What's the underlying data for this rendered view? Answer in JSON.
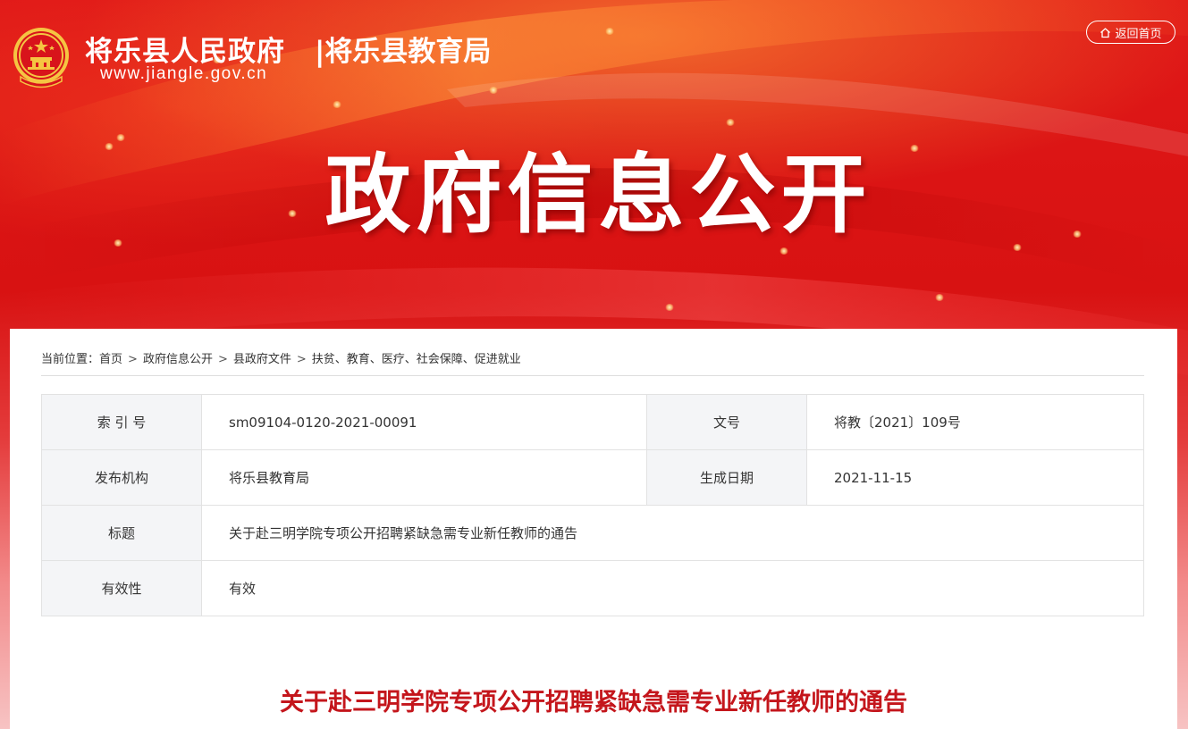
{
  "header": {
    "site_name": "将乐县人民政府",
    "site_url": "www.jiangle.gov.cn",
    "department": "|将乐县教育局",
    "home_button": "返回首页"
  },
  "hero": {
    "title": "政府信息公开"
  },
  "breadcrumb": {
    "prefix": "当前位置：",
    "items": [
      "首页",
      "政府信息公开",
      "县政府文件",
      "扶贫、教育、医疗、社会保障、促进就业"
    ],
    "separator": ">"
  },
  "meta": {
    "index_label": "索 引 号",
    "index_value": "sm09104-0120-2021-00091",
    "doc_no_label": "文号",
    "doc_no_value": "将教〔2021〕109号",
    "publisher_label": "发布机构",
    "publisher_value": "将乐县教育局",
    "date_label": "生成日期",
    "date_value": "2021-11-15",
    "title_label": "标题",
    "title_value": "关于赴三明学院专项公开招聘紧缺急需专业新任教师的通告",
    "validity_label": "有效性",
    "validity_value": "有效"
  },
  "article": {
    "title": "关于赴三明学院专项公开招聘紧缺急需专业新任教师的通告"
  },
  "colors": {
    "banner_red": "#d81212",
    "title_red": "#c4161c",
    "label_bg": "#f4f5f7"
  },
  "icons": {
    "emblem": "national-emblem-icon",
    "home": "home-icon"
  }
}
